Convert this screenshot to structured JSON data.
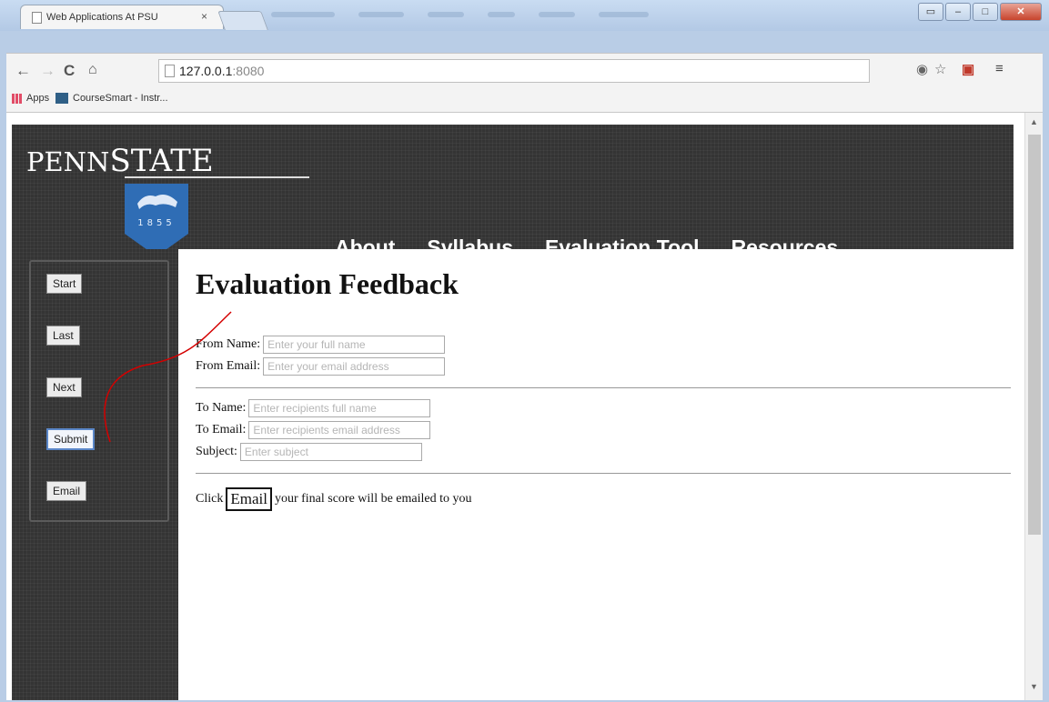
{
  "browser": {
    "tab_title": "Web Applications At PSU",
    "tab_close": "×",
    "url_host": "127.0.0.1",
    "url_port": ":8080",
    "bookmarks": [
      {
        "label": "Apps",
        "icon": "apps-grid-icon"
      },
      {
        "label": "CourseSmart - Instr...",
        "icon": "coursesmart-icon"
      }
    ],
    "nav_icons": [
      "back-arrow-icon",
      "forward-arrow-icon",
      "reload-icon",
      "home-icon"
    ],
    "toolbar_icons": [
      "location-icon",
      "star-icon",
      "pdf-extension-icon",
      "menu-icon"
    ]
  },
  "site": {
    "logo_penn": "PENN",
    "logo_state": "STATE",
    "shield_year": "1855",
    "nav": [
      "About",
      "Syllabus",
      "Evaluation Tool",
      "Resources"
    ]
  },
  "sidebar": {
    "buttons": [
      "Start",
      "Last",
      "Next",
      "Submit",
      "Email"
    ]
  },
  "form": {
    "title": "Evaluation Feedback",
    "from_name_label": "From Name:",
    "from_name_placeholder": "Enter your full name",
    "from_email_label": "From Email:",
    "from_email_placeholder": "Enter your email address",
    "to_name_label": "To Name:",
    "to_name_placeholder": "Enter recipients full name",
    "to_email_label": "To Email:",
    "to_email_placeholder": "Enter recipients email address",
    "subject_label": "Subject:",
    "subject_placeholder": "Enter subject",
    "click_prefix": "Click",
    "email_button": "Email",
    "click_suffix": "your final score will be emailed to you"
  },
  "colors": {
    "header_bg": "#343434",
    "shield_blue": "#2f6db5",
    "annotation_red": "#d40000"
  }
}
